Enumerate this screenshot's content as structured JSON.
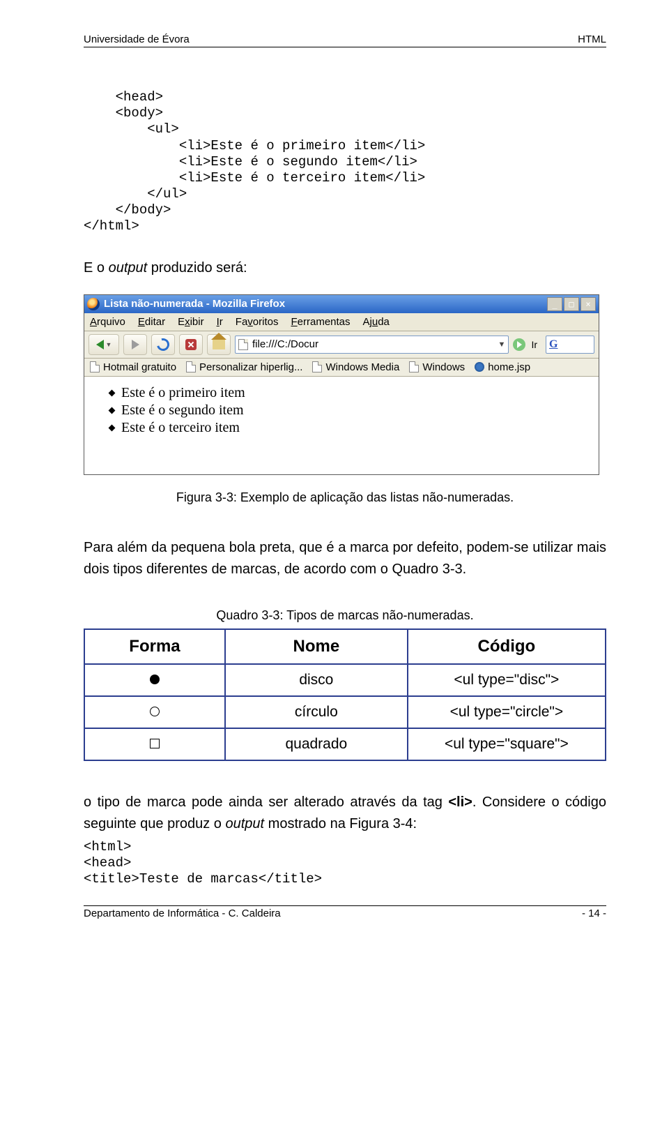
{
  "header": {
    "left": "Universidade de Évora",
    "right": "HTML"
  },
  "code1": "    <head>\n    <body>\n        <ul>\n            <li>Este é o primeiro item</li>\n            <li>Este é o segundo item</li>\n            <li>Este é o terceiro item</li>\n        </ul>\n    </body>\n</html>",
  "sentence1_a": "E o ",
  "sentence1_i": "output",
  "sentence1_b": " produzido será:",
  "browser": {
    "title": "Lista não-numerada - Mozilla Firefox",
    "menu": [
      "Arquivo",
      "Editar",
      "Exibir",
      "Ir",
      "Favoritos",
      "Ferramentas",
      "Ajuda"
    ],
    "url": "file:///C:/Docur",
    "go": "Ir",
    "bookmarks": [
      "Hotmail gratuito",
      "Personalizar hiperlig...",
      "Windows Media",
      "Windows",
      "home.jsp"
    ],
    "items": [
      "Este é o primeiro item",
      "Este é o segundo item",
      "Este é o terceiro item"
    ]
  },
  "fig_caption": "Figura 3-3: Exemplo de aplicação das listas não-numeradas.",
  "para1": "Para além da pequena bola preta, que é a marca por defeito, podem-se utilizar mais dois tipos diferentes de marcas, de acordo com o Quadro 3-3.",
  "table_caption": "Quadro 3-3: Tipos de marcas não-numeradas.",
  "table": {
    "headers": [
      "Forma",
      "Nome",
      "Código"
    ],
    "rows": [
      {
        "nome": "disco",
        "codigo": "<ul type=\"disc\">"
      },
      {
        "nome": "círculo",
        "codigo": "<ul type=\"circle\">"
      },
      {
        "nome": "quadrado",
        "codigo": "<ul type=\"square\">"
      }
    ]
  },
  "para2_a": "o tipo de marca pode ainda ser alterado através da tag ",
  "para2_b": "<li>",
  "para2_c": ". Considere o código seguinte que produz o ",
  "para2_i": "output",
  "para2_d": " mostrado na Figura 3-4:",
  "code2": "<html>\n<head>\n<title>Teste de marcas</title>",
  "footer": {
    "left": "Departamento de Informática - C. Caldeira",
    "right": "- 14 -"
  }
}
